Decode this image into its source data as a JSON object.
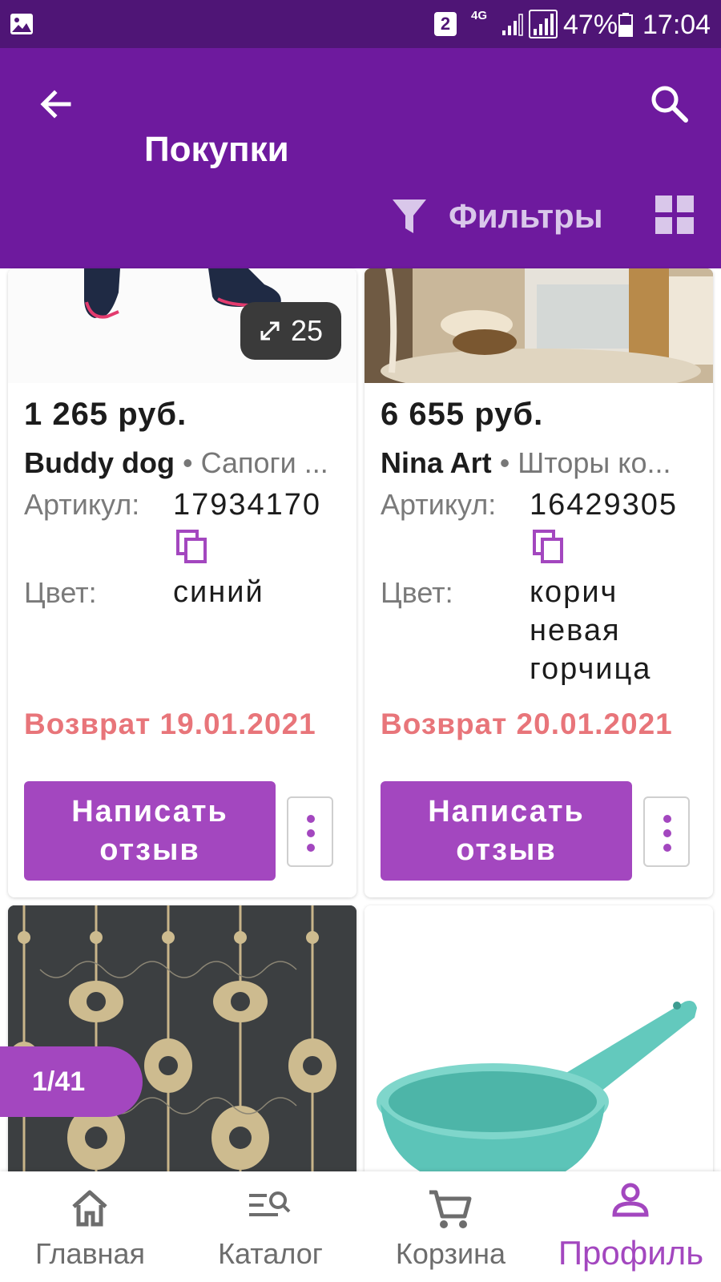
{
  "status_bar": {
    "sim": "2",
    "network": "4G",
    "battery": "47%",
    "time": "17:04"
  },
  "app_bar": {
    "title": "Покупки",
    "filters_label": "Фильтры"
  },
  "products": [
    {
      "zoom_count": "25",
      "price": "1 265 руб.",
      "brand": "Buddy dog",
      "category": " • Сапоги ...",
      "article_label": "Артикул:",
      "article": "17934170",
      "color_label": "Цвет:",
      "color": "синий",
      "return_date": "Возврат 19.01.2021",
      "review_label": "Написать отзыв"
    },
    {
      "price": "6 655 руб.",
      "brand": "Nina Art",
      "category": " • Шторы ко...",
      "article_label": "Артикул:",
      "article": "16429305",
      "color_label": "Цвет:",
      "color": "корич невая горчица",
      "return_date": "Возврат 20.01.2021",
      "review_label": "Написать отзыв"
    }
  ],
  "pager": "1/41",
  "bottom_nav": [
    {
      "label": "Главная",
      "icon": "home-icon"
    },
    {
      "label": "Каталог",
      "icon": "catalog-search-icon"
    },
    {
      "label": "Корзина",
      "icon": "cart-icon"
    },
    {
      "label": "Профиль",
      "icon": "profile-icon",
      "active": true
    }
  ],
  "colors": {
    "status_bar": "#4f1576",
    "app_bar": "#6e1a9e",
    "accent": "#a347bf",
    "return_text": "#e8757a"
  }
}
